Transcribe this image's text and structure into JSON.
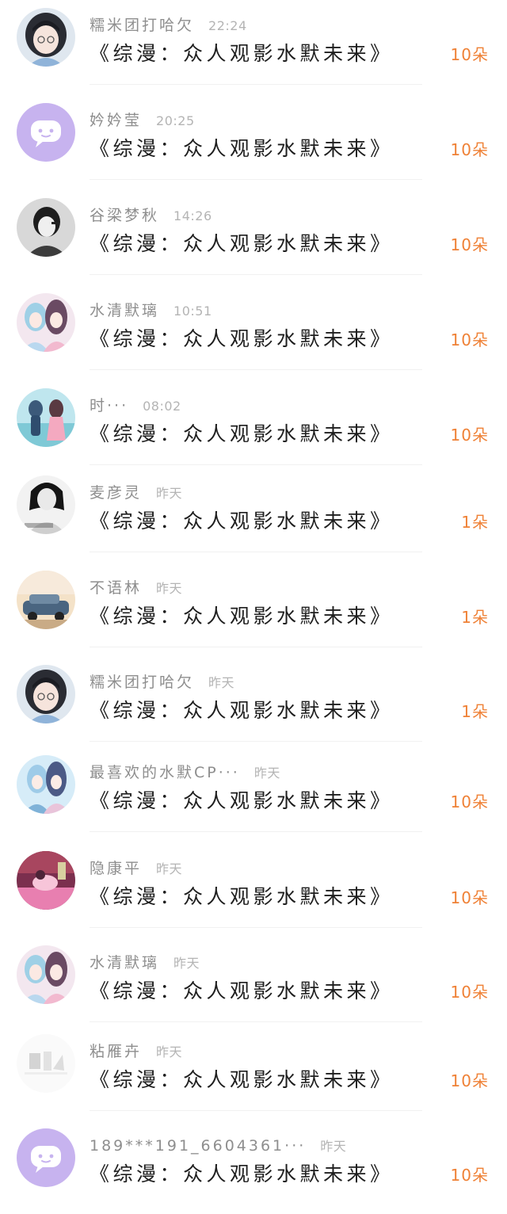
{
  "items": [
    {
      "name": "糯米团打哈欠",
      "time": "22:24",
      "title": "《综漫：众人观影水默未来》",
      "count": "10朵",
      "avatar": "avatar-girl-dark-hair-glasses"
    },
    {
      "name": "妗妗莹",
      "time": "20:25",
      "title": "《综漫：众人观影水默未来》",
      "count": "10朵",
      "avatar": "avatar-default-chat"
    },
    {
      "name": "谷梁梦秋",
      "time": "14:26",
      "title": "《综漫：众人观影水默未来》",
      "count": "10朵",
      "avatar": "avatar-bw-portrait"
    },
    {
      "name": "水清默璃",
      "time": "10:51",
      "title": "《综漫：众人观影水默未来》",
      "count": "10朵",
      "avatar": "avatar-anime-couple-pink"
    },
    {
      "name": "时···",
      "time": "08:02",
      "title": "《综漫：众人观影水默未来》",
      "count": "10朵",
      "avatar": "avatar-anime-couple-teal"
    },
    {
      "name": "麦彦灵",
      "time": "昨天",
      "title": "《综漫：众人观影水默未来》",
      "count": "1朵",
      "avatar": "avatar-bw-girl"
    },
    {
      "name": "不语林",
      "time": "昨天",
      "title": "《综漫：众人观影水默未来》",
      "count": "1朵",
      "avatar": "avatar-car-scene"
    },
    {
      "name": "糯米团打哈欠",
      "time": "昨天",
      "title": "《综漫：众人观影水默未来》",
      "count": "1朵",
      "avatar": "avatar-girl-dark-hair-glasses"
    },
    {
      "name": "最喜欢的水默CP···",
      "time": "昨天",
      "title": "《综漫：众人观影水默未来》",
      "count": "10朵",
      "avatar": "avatar-anime-couple-blue"
    },
    {
      "name": "隐康平",
      "time": "昨天",
      "title": "《综漫：众人观影水默未来》",
      "count": "10朵",
      "avatar": "avatar-pink-scene"
    },
    {
      "name": "水清默璃",
      "time": "昨天",
      "title": "《综漫：众人观影水默未来》",
      "count": "10朵",
      "avatar": "avatar-anime-couple-pink"
    },
    {
      "name": "粘雁卉",
      "time": "昨天",
      "title": "《综漫：众人观影水默未来》",
      "count": "10朵",
      "avatar": "avatar-faded-sketch"
    },
    {
      "name": "189***191_6604361···",
      "time": "昨天",
      "title": "《综漫：众人观影水默未来》",
      "count": "10朵",
      "avatar": "avatar-default-chat"
    }
  ],
  "colors": {
    "accent": "#ef8136",
    "name_text": "#8e8e8e",
    "time_text": "#b4b4b4",
    "title_text": "#1e1e1e",
    "default_avatar_bg": "#c7b3ef"
  }
}
